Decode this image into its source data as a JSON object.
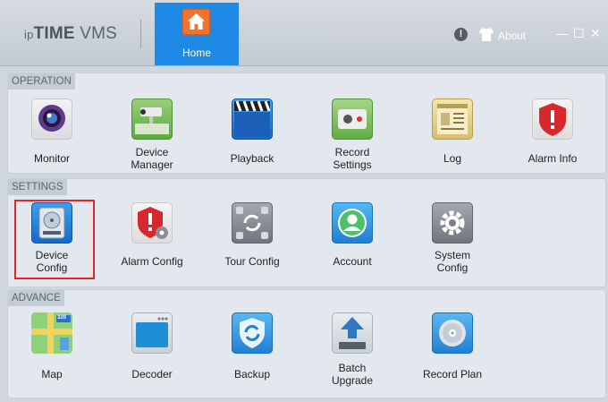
{
  "app": {
    "brand_prefix": "ip",
    "brand_main": "TIME",
    "brand_suffix": "VMS"
  },
  "header": {
    "home_label": "Home",
    "about_label": "About",
    "info_icon": "!"
  },
  "window": {
    "minimize": "—",
    "maximize": "☐",
    "close": "✕"
  },
  "sections": {
    "operation": {
      "title": "OPERATION",
      "items": [
        "Monitor",
        "Device\nManager",
        "Playback",
        "Record\nSettings",
        "Log",
        "Alarm Info"
      ]
    },
    "settings": {
      "title": "SETTINGS",
      "items": [
        "Device\nConfig",
        "Alarm Config",
        "Tour Config",
        "Account",
        "System\nConfig"
      ]
    },
    "advance": {
      "title": "ADVANCE",
      "items": [
        "Map",
        "Decoder",
        "Backup",
        "Batch\nUpgrade",
        "Record Plan"
      ]
    }
  },
  "selected_item": "Device Config",
  "map_badge": "320",
  "colors": {
    "accent": "#1f8ae6",
    "home_icon": "#f0742f",
    "selection": "#e5252a"
  }
}
